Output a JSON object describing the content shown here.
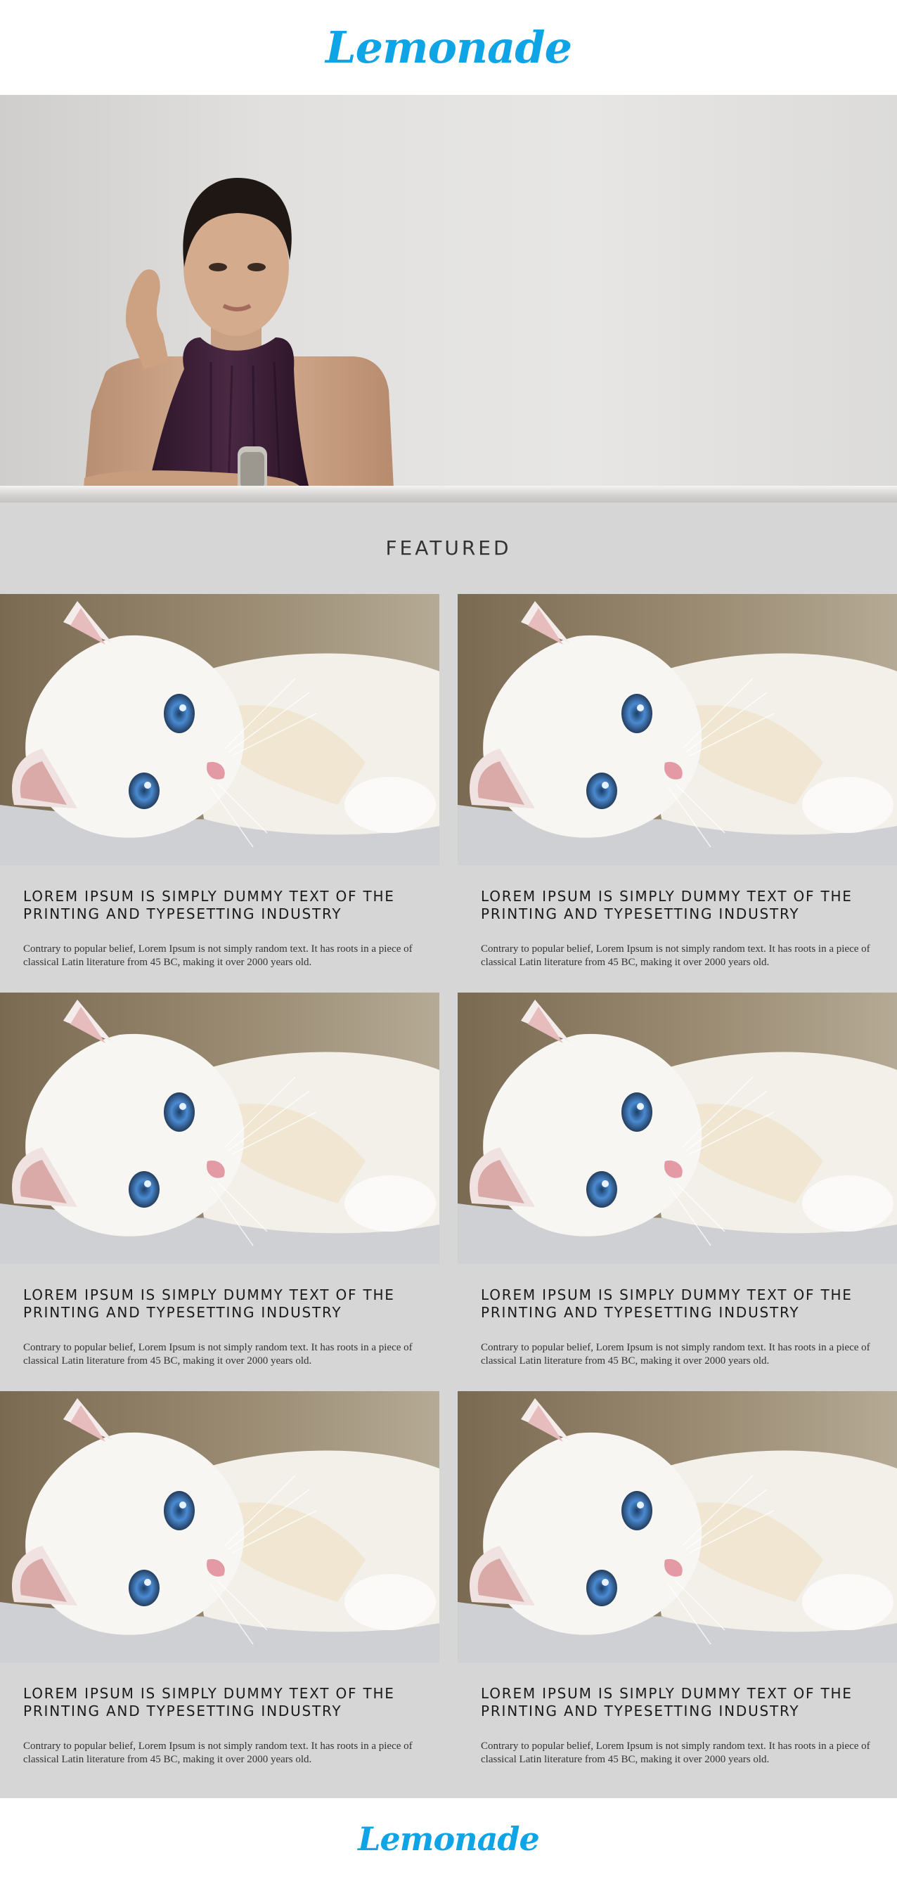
{
  "brand": {
    "name": "Lemonade",
    "color": "#0fa4e6"
  },
  "hero": {
    "image": "portrait of a woman in a sleeveless plum top leaning on a ledge"
  },
  "featured": {
    "title": "FEATURED",
    "cards": [
      {
        "image": "white-kitten-photo",
        "title": "LOREM IPSUM IS SIMPLY DUMMY TEXT OF THE PRINTING AND TYPESETTING INDUSTRY",
        "text": "Contrary to popular belief, Lorem Ipsum is not simply random text. It has roots in a piece of classical Latin literature from 45 BC, making it over 2000 years old."
      },
      {
        "image": "white-kitten-photo",
        "title": "LOREM IPSUM IS SIMPLY DUMMY TEXT OF THE PRINTING AND TYPESETTING INDUSTRY",
        "text": "Contrary to popular belief, Lorem Ipsum is not simply random text. It has roots in a piece of classical Latin literature from 45 BC, making it over 2000 years old."
      },
      {
        "image": "white-kitten-photo",
        "title": "LOREM IPSUM IS SIMPLY DUMMY TEXT OF THE PRINTING AND TYPESETTING INDUSTRY",
        "text": "Contrary to popular belief, Lorem Ipsum is not simply random text. It has roots in a piece of classical Latin literature from 45 BC, making it over 2000 years old."
      },
      {
        "image": "white-kitten-photo",
        "title": "LOREM IPSUM IS SIMPLY DUMMY TEXT OF THE PRINTING AND TYPESETTING INDUSTRY",
        "text": "Contrary to popular belief, Lorem Ipsum is not simply random text. It has roots in a piece of classical Latin literature from 45 BC, making it over 2000 years old."
      },
      {
        "image": "white-kitten-photo",
        "title": "LOREM IPSUM IS SIMPLY DUMMY TEXT OF THE PRINTING AND TYPESETTING INDUSTRY",
        "text": "Contrary to popular belief, Lorem Ipsum is not simply random text. It has roots in a piece of classical Latin literature from 45 BC, making it over 2000 years old."
      },
      {
        "image": "white-kitten-photo",
        "title": "LOREM IPSUM IS SIMPLY DUMMY TEXT OF THE PRINTING AND TYPESETTING INDUSTRY",
        "text": "Contrary to popular belief, Lorem Ipsum is not simply random text. It has roots in a piece of classical Latin literature from 45 BC, making it over 2000 years old."
      }
    ]
  },
  "footer": {
    "logo": "Lemonade"
  }
}
